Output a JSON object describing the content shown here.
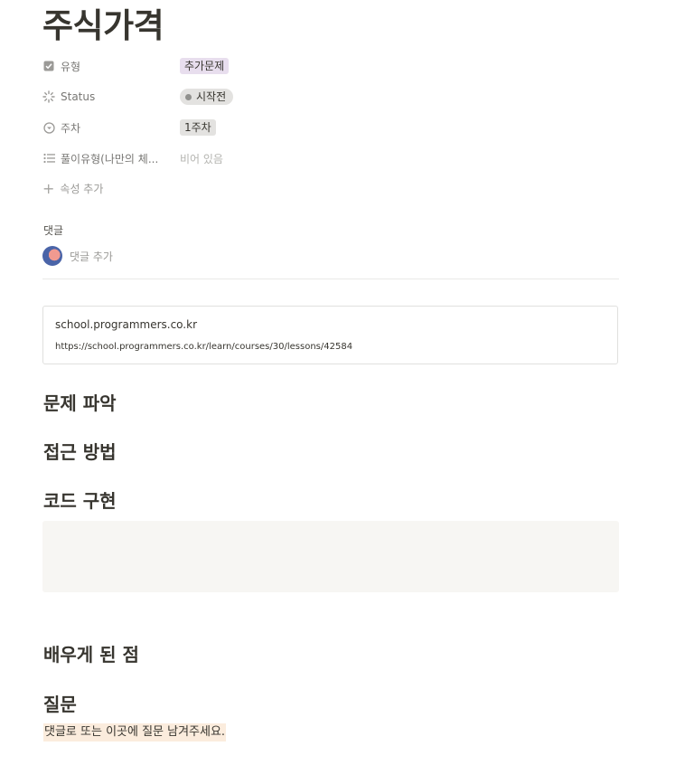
{
  "page": {
    "title": "주식가격"
  },
  "properties": [
    {
      "name": "유형",
      "icon": "checkbox-icon",
      "value": "추가문제",
      "kind": "tag",
      "color": "#e8deee"
    },
    {
      "name": "Status",
      "icon": "status-icon",
      "value": "시작전",
      "kind": "status",
      "color": "#e3e2e0"
    },
    {
      "name": "주차",
      "icon": "select-icon",
      "value": "1주차",
      "kind": "tag",
      "color": "#e3e2e0"
    },
    {
      "name": "풀이유형(나만의 체...",
      "icon": "list-icon",
      "value": "비어 있음",
      "kind": "empty"
    }
  ],
  "add_property_label": "속성 추가",
  "comments": {
    "label": "댓글",
    "add_placeholder": "댓글 추가"
  },
  "bookmark": {
    "title": "school.programmers.co.kr",
    "url": "https://school.programmers.co.kr/learn/courses/30/lessons/42584"
  },
  "headings": [
    "문제 파악",
    "접근 방법",
    "코드 구현",
    "배우게 된 점",
    "질문"
  ],
  "question_note": "댓글로 또는 이곳에 질문 남겨주세요."
}
